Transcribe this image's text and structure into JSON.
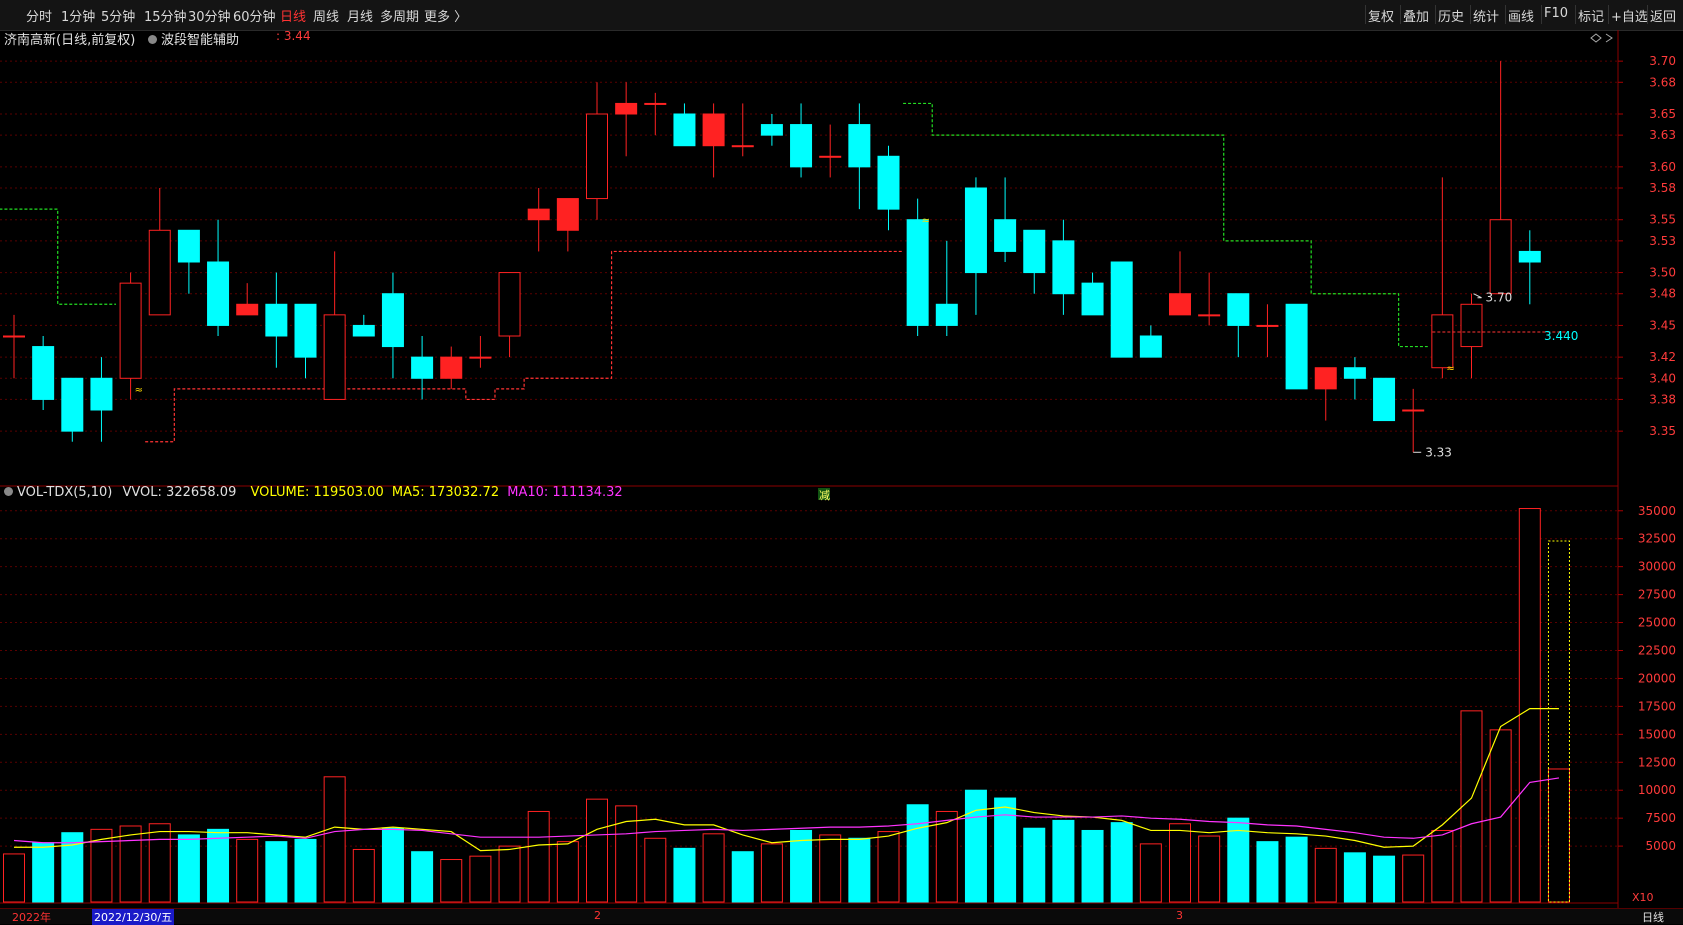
{
  "topbar": {
    "periods": [
      {
        "label": "分时",
        "active": false
      },
      {
        "label": "1分钟",
        "active": false
      },
      {
        "label": "5分钟",
        "active": false
      },
      {
        "label": "15分钟",
        "active": false
      },
      {
        "label": "30分钟",
        "active": false
      },
      {
        "label": "60分钟",
        "active": false
      },
      {
        "label": "日线",
        "active": true
      },
      {
        "label": "周线",
        "active": false
      },
      {
        "label": "月线",
        "active": false
      },
      {
        "label": "多周期",
        "active": false
      },
      {
        "label": "更多 〉",
        "active": false
      }
    ],
    "tools": [
      "复权",
      "叠加",
      "历史",
      "统计",
      "画线",
      "F10",
      "标记",
      "+自选",
      "返回"
    ]
  },
  "header": {
    "stock": "济南高新(日线,前复权)",
    "indicator": "波段智能辅助",
    "indicator_value": ": 3.44"
  },
  "vol_header": {
    "name": "VOL-TDX(5,10)",
    "vvol_label": "VVOL: 322658.09",
    "volume_label": "VOLUME: 119503.00",
    "ma5_label": "MA5: 173032.72",
    "ma10_label": "MA10: 111134.32"
  },
  "price_axis_ticks": [
    "3.70",
    "3.68",
    "3.65",
    "3.63",
    "3.60",
    "3.58",
    "3.55",
    "3.53",
    "3.50",
    "3.48",
    "3.45",
    "3.42",
    "3.40",
    "3.38",
    "3.35"
  ],
  "volume_axis_ticks": [
    "35000",
    "32500",
    "30000",
    "27500",
    "25000",
    "22500",
    "20000",
    "17500",
    "15000",
    "12500",
    "10000",
    "7500",
    "5000"
  ],
  "volume_unit": "X10",
  "annotations": {
    "high": "3.70",
    "low": "3.33",
    "last": "3.440",
    "signal": "减"
  },
  "bottom": {
    "year_label": "2022年",
    "date_label": "2022/12/30/五",
    "month2": "2",
    "month3": "3",
    "period_label": "日线"
  },
  "colors": {
    "up": "#ff2222",
    "down": "#00ffff",
    "ma5": "#ffff00",
    "ma10": "#ff33ff",
    "support": "#ff3333",
    "resistance": "#22dd22"
  },
  "chart_data": {
    "type": "candlestick",
    "candles": [
      {
        "o": 3.44,
        "h": 3.46,
        "l": 3.4,
        "c": 3.44
      },
      {
        "o": 3.43,
        "h": 3.44,
        "l": 3.37,
        "c": 3.38
      },
      {
        "o": 3.4,
        "h": 3.4,
        "l": 3.34,
        "c": 3.35
      },
      {
        "o": 3.4,
        "h": 3.42,
        "l": 3.34,
        "c": 3.37
      },
      {
        "o": 3.4,
        "h": 3.5,
        "l": 3.38,
        "c": 3.49
      },
      {
        "o": 3.46,
        "h": 3.58,
        "l": 3.46,
        "c": 3.54
      },
      {
        "o": 3.54,
        "h": 3.54,
        "l": 3.48,
        "c": 3.51
      },
      {
        "o": 3.51,
        "h": 3.55,
        "l": 3.44,
        "c": 3.45
      },
      {
        "o": 3.46,
        "h": 3.49,
        "l": 3.46,
        "c": 3.47
      },
      {
        "o": 3.47,
        "h": 3.5,
        "l": 3.41,
        "c": 3.44
      },
      {
        "o": 3.47,
        "h": 3.47,
        "l": 3.4,
        "c": 3.42
      },
      {
        "o": 3.38,
        "h": 3.52,
        "l": 3.38,
        "c": 3.46
      },
      {
        "o": 3.45,
        "h": 3.46,
        "l": 3.44,
        "c": 3.44
      },
      {
        "o": 3.48,
        "h": 3.5,
        "l": 3.4,
        "c": 3.43
      },
      {
        "o": 3.42,
        "h": 3.44,
        "l": 3.38,
        "c": 3.4
      },
      {
        "o": 3.4,
        "h": 3.43,
        "l": 3.39,
        "c": 3.42
      },
      {
        "o": 3.42,
        "h": 3.44,
        "l": 3.41,
        "c": 3.42
      },
      {
        "o": 3.44,
        "h": 3.5,
        "l": 3.42,
        "c": 3.5
      },
      {
        "o": 3.55,
        "h": 3.58,
        "l": 3.52,
        "c": 3.56
      },
      {
        "o": 3.54,
        "h": 3.57,
        "l": 3.52,
        "c": 3.57
      },
      {
        "o": 3.57,
        "h": 3.68,
        "l": 3.55,
        "c": 3.65
      },
      {
        "o": 3.65,
        "h": 3.68,
        "l": 3.61,
        "c": 3.66
      },
      {
        "o": 3.66,
        "h": 3.67,
        "l": 3.63,
        "c": 3.66
      },
      {
        "o": 3.65,
        "h": 3.66,
        "l": 3.62,
        "c": 3.62
      },
      {
        "o": 3.62,
        "h": 3.66,
        "l": 3.59,
        "c": 3.65
      },
      {
        "o": 3.62,
        "h": 3.66,
        "l": 3.61,
        "c": 3.62
      },
      {
        "o": 3.64,
        "h": 3.65,
        "l": 3.62,
        "c": 3.63
      },
      {
        "o": 3.64,
        "h": 3.66,
        "l": 3.59,
        "c": 3.6
      },
      {
        "o": 3.61,
        "h": 3.64,
        "l": 3.59,
        "c": 3.61
      },
      {
        "o": 3.64,
        "h": 3.66,
        "l": 3.56,
        "c": 3.6
      },
      {
        "o": 3.61,
        "h": 3.62,
        "l": 3.54,
        "c": 3.56
      },
      {
        "o": 3.55,
        "h": 3.57,
        "l": 3.44,
        "c": 3.45
      },
      {
        "o": 3.47,
        "h": 3.53,
        "l": 3.44,
        "c": 3.45
      },
      {
        "o": 3.58,
        "h": 3.59,
        "l": 3.46,
        "c": 3.5
      },
      {
        "o": 3.55,
        "h": 3.59,
        "l": 3.51,
        "c": 3.52
      },
      {
        "o": 3.54,
        "h": 3.54,
        "l": 3.48,
        "c": 3.5
      },
      {
        "o": 3.53,
        "h": 3.55,
        "l": 3.46,
        "c": 3.48
      },
      {
        "o": 3.49,
        "h": 3.5,
        "l": 3.46,
        "c": 3.46
      },
      {
        "o": 3.51,
        "h": 3.51,
        "l": 3.42,
        "c": 3.42
      },
      {
        "o": 3.44,
        "h": 3.45,
        "l": 3.42,
        "c": 3.42
      },
      {
        "o": 3.46,
        "h": 3.52,
        "l": 3.46,
        "c": 3.48
      },
      {
        "o": 3.46,
        "h": 3.5,
        "l": 3.45,
        "c": 3.46
      },
      {
        "o": 3.48,
        "h": 3.48,
        "l": 3.42,
        "c": 3.45
      },
      {
        "o": 3.45,
        "h": 3.47,
        "l": 3.42,
        "c": 3.45
      },
      {
        "o": 3.47,
        "h": 3.47,
        "l": 3.39,
        "c": 3.39
      },
      {
        "o": 3.39,
        "h": 3.41,
        "l": 3.36,
        "c": 3.41
      },
      {
        "o": 3.41,
        "h": 3.42,
        "l": 3.38,
        "c": 3.4
      },
      {
        "o": 3.4,
        "h": 3.4,
        "l": 3.36,
        "c": 3.36
      },
      {
        "o": 3.37,
        "h": 3.39,
        "l": 3.33,
        "c": 3.37
      },
      {
        "o": 3.41,
        "h": 3.59,
        "l": 3.4,
        "c": 3.46
      },
      {
        "o": 3.43,
        "h": 3.48,
        "l": 3.4,
        "c": 3.47
      },
      {
        "o": 3.48,
        "h": 3.7,
        "l": 3.48,
        "c": 3.55
      },
      {
        "o": 3.52,
        "h": 3.54,
        "l": 3.47,
        "c": 3.51
      }
    ],
    "volume": [
      4300,
      5300,
      6200,
      6500,
      6800,
      7000,
      6000,
      6500,
      5600,
      5400,
      5600,
      11200,
      4700,
      6600,
      4500,
      3800,
      4100,
      5000,
      8100,
      5400,
      9200,
      8600,
      5700,
      4800,
      6100,
      4500,
      5200,
      6400,
      6000,
      5700,
      6300,
      8700,
      8100,
      10000,
      9300,
      6600,
      7300,
      6400,
      7100,
      5200,
      7000,
      5900,
      7500,
      5400,
      5800,
      4800,
      4400,
      4100,
      4200,
      6400,
      17100,
      15400,
      35200,
      11900
    ],
    "volume_dir": [
      "u",
      "d",
      "d",
      "u",
      "u",
      "u",
      "d",
      "d",
      "u",
      "d",
      "d",
      "u",
      "u",
      "d",
      "d",
      "u",
      "u",
      "u",
      "u",
      "u",
      "u",
      "u",
      "u",
      "d",
      "u",
      "d",
      "u",
      "d",
      "u",
      "d",
      "u",
      "d",
      "u",
      "d",
      "d",
      "d",
      "d",
      "d",
      "d",
      "u",
      "u",
      "u",
      "d",
      "d",
      "d",
      "u",
      "d",
      "d",
      "u",
      "u",
      "u",
      "u",
      "u",
      "u"
    ],
    "ma5": [
      4900,
      4900,
      5100,
      5600,
      6000,
      6300,
      6300,
      6200,
      6200,
      6000,
      5800,
      6700,
      6500,
      6700,
      6500,
      6300,
      4600,
      4700,
      5100,
      5200,
      6500,
      7200,
      7400,
      6900,
      6900,
      6000,
      5300,
      5500,
      5600,
      5600,
      5900,
      6600,
      7100,
      8200,
      8500,
      8000,
      7700,
      7600,
      7300,
      6400,
      6400,
      6200,
      6400,
      6200,
      6100,
      5900,
      5500,
      4900,
      5000,
      6900,
      9300,
      15700,
      17300,
      17300
    ],
    "ma10": [
      5500,
      5300,
      5300,
      5400,
      5500,
      5600,
      5600,
      5700,
      5800,
      5900,
      5700,
      6300,
      6500,
      6500,
      6400,
      6100,
      5800,
      5800,
      5800,
      5900,
      6000,
      6100,
      6300,
      6400,
      6500,
      6400,
      6500,
      6600,
      6700,
      6700,
      6800,
      7000,
      7300,
      7600,
      7800,
      7600,
      7600,
      7600,
      7700,
      7500,
      7400,
      7200,
      7100,
      6900,
      6800,
      6500,
      6200,
      5800,
      5700,
      6000,
      7000,
      7600,
      10700,
      11100
    ],
    "support_line": [
      null,
      null,
      null,
      null,
      null,
      3.34,
      3.39,
      3.39,
      3.39,
      3.39,
      3.39,
      3.39,
      3.39,
      3.39,
      3.39,
      3.39,
      3.38,
      3.39,
      3.4,
      3.4,
      3.4,
      3.52,
      3.52,
      3.52,
      3.52,
      3.52,
      3.52,
      3.52,
      3.52,
      3.52,
      3.52,
      null,
      null,
      null,
      null,
      null,
      null,
      null,
      null,
      null,
      null,
      null,
      null,
      null,
      null,
      null,
      null,
      null,
      null,
      null,
      null,
      null,
      null,
      null
    ],
    "resistance_line": [
      3.56,
      3.56,
      3.47,
      3.47,
      null,
      null,
      null,
      null,
      null,
      null,
      null,
      null,
      null,
      null,
      null,
      null,
      null,
      null,
      null,
      null,
      null,
      null,
      null,
      null,
      null,
      null,
      null,
      null,
      null,
      null,
      null,
      3.66,
      3.63,
      3.63,
      3.63,
      3.63,
      3.63,
      3.63,
      3.63,
      3.63,
      3.63,
      3.63,
      3.53,
      3.53,
      3.53,
      3.48,
      3.48,
      3.48,
      3.43,
      null,
      null,
      null,
      null,
      null
    ],
    "price_range": [
      3.3,
      3.72
    ],
    "volume_range": [
      0,
      36500
    ]
  }
}
